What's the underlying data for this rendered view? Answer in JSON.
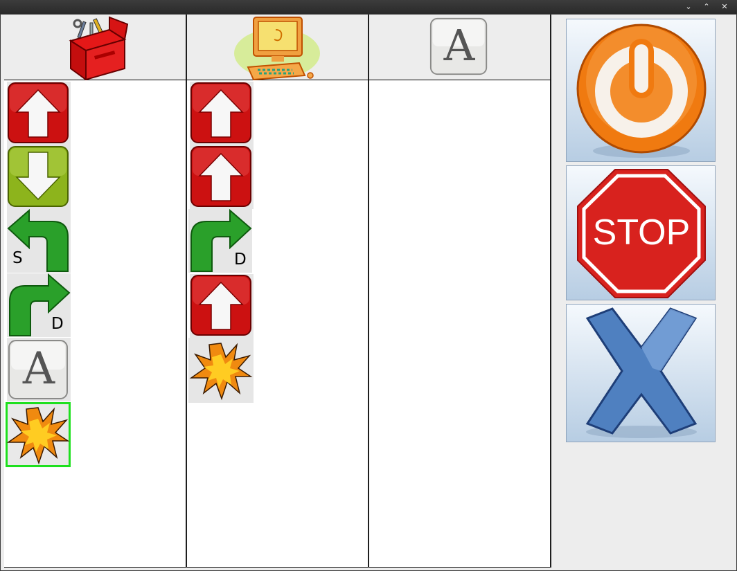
{
  "window": {
    "controls": {
      "minimize_glyph": "⌄",
      "maximize_glyph": "⌃",
      "close_glyph": "✕"
    }
  },
  "columns": [
    {
      "header_icon": "toolbox-icon",
      "items": [
        {
          "icon": "arrow-up-icon",
          "color": "#cc1111"
        },
        {
          "icon": "arrow-down-icon",
          "color": "#8db41c"
        },
        {
          "icon": "turn-left-icon",
          "label": "S"
        },
        {
          "icon": "turn-right-icon",
          "label": "D"
        },
        {
          "icon": "letter-a-icon",
          "glyph": "A"
        },
        {
          "icon": "explosion-icon",
          "selected": true
        }
      ]
    },
    {
      "header_icon": "computer-icon",
      "items": [
        {
          "icon": "arrow-up-icon",
          "color": "#cc1111"
        },
        {
          "icon": "arrow-up-icon",
          "color": "#cc1111"
        },
        {
          "icon": "turn-right-icon",
          "label": "D"
        },
        {
          "icon": "arrow-up-icon",
          "color": "#cc1111"
        },
        {
          "icon": "explosion-icon"
        }
      ]
    },
    {
      "header_icon": "letter-a-icon",
      "header_glyph": "A",
      "items": []
    }
  ],
  "controls": {
    "power": {
      "icon": "power-icon",
      "color": "#f07a10"
    },
    "stop": {
      "icon": "stop-sign-icon",
      "label": "STOP",
      "color": "#d8221e"
    },
    "close": {
      "icon": "close-x-icon",
      "color": "#4f80c0"
    }
  }
}
